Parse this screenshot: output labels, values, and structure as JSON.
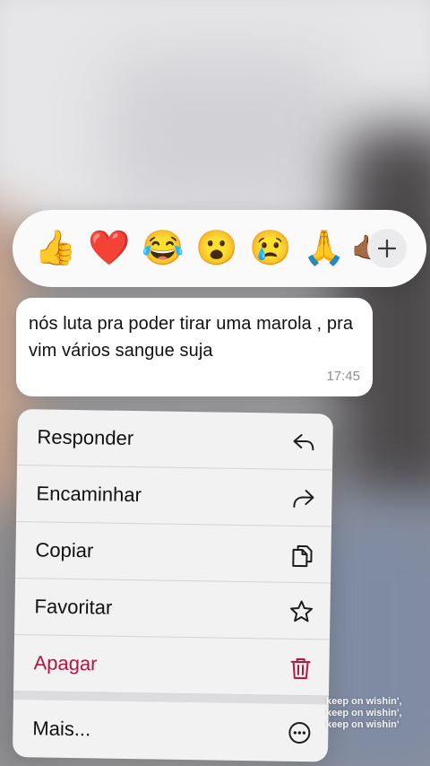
{
  "reactions": {
    "emojis": [
      "👍",
      "❤️",
      "😂",
      "😮",
      "😢",
      "🙏",
      "🤙🏾"
    ],
    "more_label": "+"
  },
  "message": {
    "text": "nós luta pra poder tirar uma marola , pra vim vários sangue suja",
    "time": "17:45"
  },
  "menu": {
    "items": [
      {
        "label": "Responder",
        "icon": "reply-icon"
      },
      {
        "label": "Encaminhar",
        "icon": "forward-icon"
      },
      {
        "label": "Copiar",
        "icon": "copy-icon"
      },
      {
        "label": "Favoritar",
        "icon": "star-icon"
      },
      {
        "label": "Apagar",
        "icon": "trash-icon",
        "color": "#b5153f"
      }
    ],
    "more": {
      "label": "Mais...",
      "icon": "more-icon"
    }
  },
  "watermark": {
    "lines": [
      "keep on wishin',",
      "keep on wishin',",
      "keep on wishin'"
    ]
  }
}
